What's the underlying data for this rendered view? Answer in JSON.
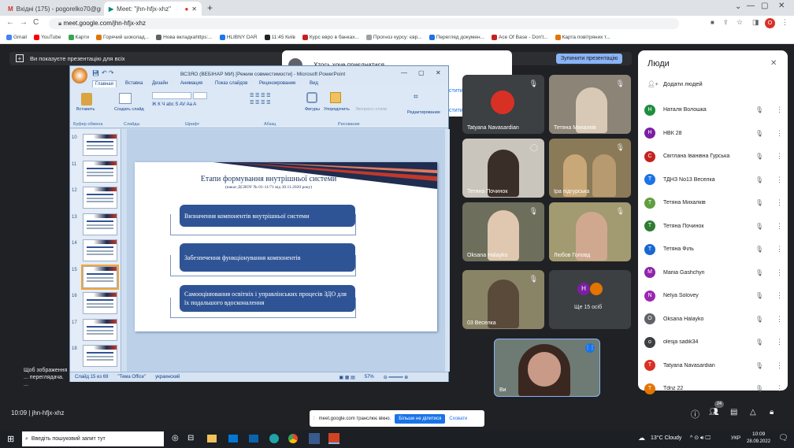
{
  "browser": {
    "tabs": [
      {
        "icon": "gmail-icon",
        "title": "Вхідні (175) - pogorelko70@gm"
      },
      {
        "icon": "meet-icon",
        "title": "Meet: \"jhn-hfjx-xhz\""
      }
    ],
    "url": "meet.google.com/jhn-hfjx-xhz",
    "bookmarks": [
      "Gmail",
      "YouTube",
      "Карти",
      "Горячий шоколад...",
      "Нова вкладкаhttps:...",
      "HLIBNY DAR",
      "11:45 Київ",
      "Курс евро в банках...",
      "Прогноз курсу: євр...",
      "Перегляд докумен...",
      "Ace Of Base - Don't...",
      "Карта повітряних т..."
    ]
  },
  "meet": {
    "present_banner": "Ви показуєте презентацію для всіх",
    "stop_presenting": "Зупинити презентацію",
    "popup_title": "Хтось хоче приєднатися",
    "popup_link1": "стити",
    "popup_link2": "стити",
    "tiles": [
      "Tatyana Navasardian",
      "Тетяна Михалків",
      "Тетяна Починок",
      "Іра підгурська",
      "Oksana Halayko",
      "Любов Головд",
      "03 Веселка",
      "Ще 15 осіб",
      "Ви"
    ],
    "side_note": "Щоб зображення ... переглядача. ...",
    "meeting_time": "10:09",
    "meeting_code": "jhn-hfjx-xhz",
    "sharing_text": "meet.google.com транслює вікно.",
    "stop_sharing": "Більше не ділитися",
    "hide": "Сховати",
    "others_count": "24",
    "more_initials": "Н"
  },
  "people": {
    "title": "Люди",
    "add": "Додати людей",
    "list": [
      {
        "initial": "Н",
        "color": "#1e8e3e",
        "name": "Наталя Волошка"
      },
      {
        "initial": "Н",
        "color": "#7b1fa2",
        "name": "НВК 28"
      },
      {
        "initial": "С",
        "color": "#c5221f",
        "name": "Світлана Іванівна Гурська"
      },
      {
        "initial": "Т",
        "color": "#1a73e8",
        "name": "ТДНЗ No13 Веселка"
      },
      {
        "initial": "Т",
        "color": "#5f9e3e",
        "name": "Тетяна Михалків"
      },
      {
        "initial": "Т",
        "color": "#2e7d32",
        "name": "Тетяна Починок"
      },
      {
        "initial": "Т",
        "color": "#1967d2",
        "name": "Тетяна Філь"
      },
      {
        "initial": "M",
        "color": "#8e24aa",
        "name": "Mariia Gashchyn"
      },
      {
        "initial": "N",
        "color": "#9c27b0",
        "name": "Nelya Solovey"
      },
      {
        "initial": "O",
        "color": "#5f6368",
        "name": "Oksana Halayko"
      },
      {
        "initial": "o",
        "color": "#3c4043",
        "name": "olesja sadik34"
      },
      {
        "initial": "T",
        "color": "#d93025",
        "name": "Tatyana Navasardian"
      },
      {
        "initial": "T",
        "color": "#e37400",
        "name": "Tdnz 22"
      }
    ]
  },
  "ppt": {
    "title": "ВСЗЯО (ВЕБІНАР МИ) [Режим совместимости] - Microsoft PowerPoint",
    "tabs": [
      "Главная",
      "Вставка",
      "Дизайн",
      "Анимация",
      "Показ слайдов",
      "Рецензирование",
      "Вид"
    ],
    "groups": [
      "Буфер обмена",
      "Слайды",
      "Шрифт",
      "Абзац",
      "Рисование",
      "Редактирование"
    ],
    "buttons": [
      "Вставить",
      "Создать слайд",
      "Фигуры",
      "Упорядочить",
      "Экспресс-стили"
    ],
    "thumb_numbers": [
      "10",
      "11",
      "12",
      "13",
      "14",
      "15",
      "16",
      "17",
      "18"
    ],
    "slide_title": "Етапи формування внутрішньої системи",
    "slide_subtitle": "(наказ ДСЯОУ № 01-11/71 від 30.11.2020 року)",
    "boxes": [
      "Визначення компонентів внутрішньої системи",
      "Забезпечення функціонування компонентів",
      "Самооцінювання освітніх і управлінських процесів ЗДО для їх подальшого вдосконалення"
    ],
    "status_slide": "Слайд 15 из 69",
    "status_theme": "\"Тема Office\"",
    "status_lang": "украинский",
    "zoom": "57%"
  },
  "taskbar": {
    "search_placeholder": "Введіть пошуковий запит тут",
    "weather": "13°C Cloudy",
    "lang": "УКР",
    "time": "10:09",
    "date": "28.09.2022"
  }
}
